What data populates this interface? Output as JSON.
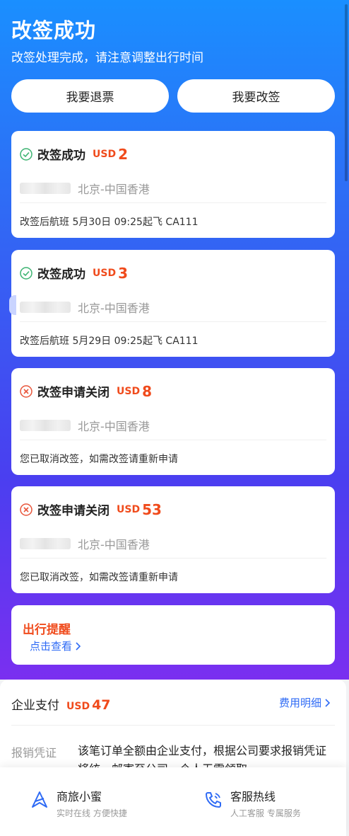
{
  "header": {
    "title": "改签成功",
    "subtitle": "改签处理完成，请注意调整出行时间"
  },
  "actions": {
    "refund_label": "我要退票",
    "change_label": "我要改签"
  },
  "cards": [
    {
      "status": "改签成功",
      "status_type": "success",
      "currency": "USD",
      "amount": "2",
      "route": "北京-中国香港",
      "note": "改签后航班 5月30日 09:25起飞 CA111"
    },
    {
      "status": "改签成功",
      "status_type": "success",
      "currency": "USD",
      "amount": "3",
      "route": "北京-中国香港",
      "note": "改签后航班 5月29日 09:25起飞 CA111"
    },
    {
      "status": "改签申请关闭",
      "status_type": "closed",
      "currency": "USD",
      "amount": "8",
      "route": "北京-中国香港",
      "note": "您已取消改签，如需改签请重新申请"
    },
    {
      "status": "改签申请关闭",
      "status_type": "closed",
      "currency": "USD",
      "amount": "53",
      "route": "北京-中国香港",
      "note": "您已取消改签，如需改签请重新申请"
    }
  ],
  "reminder": {
    "title": "出行提醒",
    "link": "点击查看"
  },
  "payment": {
    "title": "企业支付",
    "currency": "USD",
    "amount": "47",
    "detail_link": "费用明细",
    "voucher_label": "报销凭证",
    "voucher_text": "该笔订单全额由企业支付，根据公司要求报销凭证将统一邮寄至公司，个人无需领取"
  },
  "bottom_bar": {
    "assistant_title": "商旅小蜜",
    "assistant_sub": "实时在线 方便快捷",
    "hotline_title": "客服热线",
    "hotline_sub": "人工客服 专属服务"
  },
  "colors": {
    "accent": "#2f6bf5",
    "price": "#f04b1c",
    "success": "#3cb371",
    "closed": "#e8553a"
  }
}
